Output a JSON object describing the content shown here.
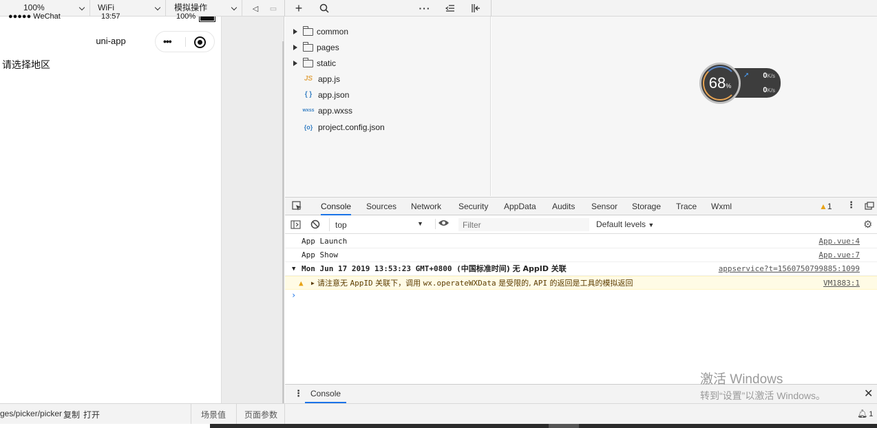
{
  "toolbar": {
    "zoom": "100%",
    "network": "WiFi",
    "simulate": "模拟操作"
  },
  "simulator": {
    "status_carrier": "●●●●● WeChat",
    "status_time": "13:57",
    "status_battery": "100%",
    "nav_title": "uni-app",
    "capsule_dots": "•••",
    "page_text": "请选择地区"
  },
  "filetree": {
    "folders": [
      "common",
      "pages",
      "static"
    ],
    "files": [
      {
        "icon": "JS",
        "name": "app.js",
        "color": "#e2a64a"
      },
      {
        "icon": "{ }",
        "name": "app.json",
        "color": "#3b82c4"
      },
      {
        "icon": "wxss",
        "name": "app.wxss",
        "color": "#3b82c4"
      },
      {
        "icon": "{o}",
        "name": "project.config.json",
        "color": "#3b82c4"
      }
    ]
  },
  "monitor": {
    "percent": "68",
    "percent_unit": "%",
    "up": "0",
    "down": "0",
    "unit": "K/s"
  },
  "devtools": {
    "tabs": [
      "Console",
      "Sources",
      "Network",
      "Security",
      "AppData",
      "Audits",
      "Sensor",
      "Storage",
      "Trace",
      "Wxml"
    ],
    "active_tab": "Console",
    "warning_count": "1",
    "context": "top",
    "filter_placeholder": "Filter",
    "levels": "Default levels",
    "logs": [
      {
        "text": "App Launch",
        "source": "App.vue:4"
      },
      {
        "text": "App Show",
        "source": "App.vue:7"
      }
    ],
    "group_text_a": "Mon Jun 17 2019 13:53:23 GMT+0800 (",
    "group_text_cn": "中国标准时间",
    "group_text_b": ") 无 AppID 关联",
    "group_source": "appservice?t=1560750799885:1099",
    "warn_a": "请注意无 ",
    "warn_b": "AppID",
    "warn_c": " 关联下，调用 ",
    "warn_d": "wx.operateWXData",
    "warn_e": " 是受限的, ",
    "warn_f": "API",
    "warn_g": " 的返回是工具的模拟返回",
    "warn_source": "VM1883:1",
    "drawer_tab": "Console"
  },
  "bottom": {
    "path": "ges/picker/picker",
    "copy": "复制",
    "open": "打开",
    "scene": "场景值",
    "params": "页面参数",
    "notif_count": "1"
  },
  "watermark": {
    "line1": "激活 Windows",
    "line2": "转到“设置”以激活 Windows。"
  }
}
